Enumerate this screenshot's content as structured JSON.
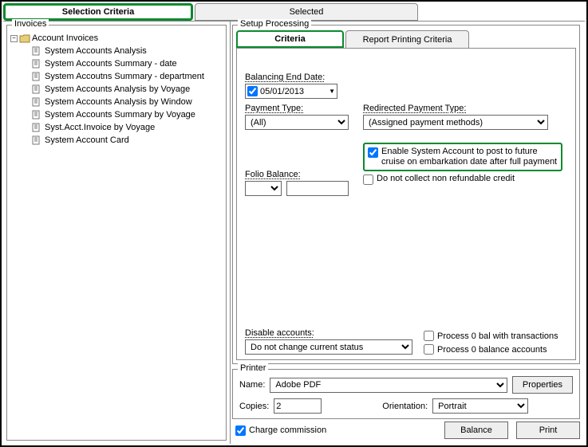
{
  "topTabs": {
    "selectionCriteria": "Selection Criteria",
    "selected": "Selected"
  },
  "invoices": {
    "groupTitle": "Invoices",
    "root": "Account Invoices",
    "items": [
      "System Accounts Analysis",
      "System Accounts Summary - date",
      "System Accoutns Summary - department",
      "System Accounts Analysis by Voyage",
      "System Accounts Analysis by Window",
      "System Accounts Summary by Voyage",
      "Syst.Acct.Invoice by Voyage",
      "System Account Card"
    ]
  },
  "setup": {
    "groupTitle": "Setup Processing",
    "tabCriteria": "Criteria",
    "tabReport": "Report Printing Criteria",
    "balancingEndDateLabel": "Balancing End Date:",
    "balancingEndDate": "05/01/2013",
    "paymentTypeLabel": "Payment Type:",
    "paymentType": "(All)",
    "redirectedLabel": "Redirected Payment Type:",
    "redirected": "(Assigned payment methods)",
    "enableFuture": "Enable System Account to post to future cruise on embarkation date after full payment",
    "noRefund": "Do not collect non refundable credit",
    "folioBalanceLabel": "Folio Balance:",
    "disableLabel": "Disable accounts:",
    "disableValue": "Do not change current status",
    "proc0trans": "Process 0 bal with transactions",
    "proc0accts": "Process 0 balance accounts"
  },
  "printer": {
    "groupTitle": "Printer",
    "nameLabel": "Name:",
    "name": "Adobe PDF",
    "copiesLabel": "Copies:",
    "copies": "2",
    "orientationLabel": "Orientation:",
    "orientation": "Portrait",
    "propertiesBtn": "Properties"
  },
  "footer": {
    "chargeCommission": "Charge commission",
    "balanceBtn": "Balance",
    "printBtn": "Print"
  }
}
